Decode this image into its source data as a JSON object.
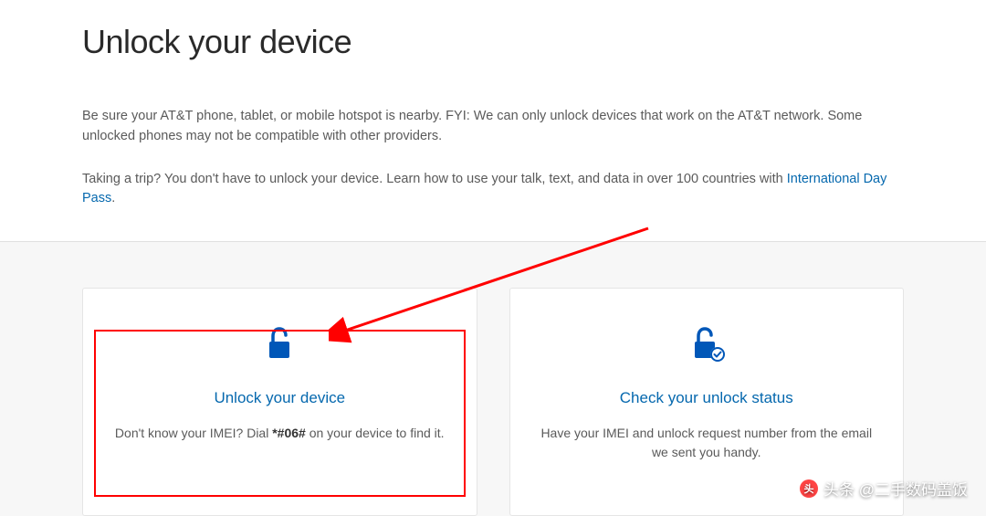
{
  "header": {
    "title": "Unlock your device",
    "intro": "Be sure your AT&T phone, tablet, or mobile hotspot is nearby. FYI: We can only unlock devices that work on the AT&T network. Some unlocked phones may not be compatible with other providers.",
    "trip_prefix": "Taking a trip? You don't have to unlock your device. Learn how to use your talk, text, and data in over 100 countries with ",
    "trip_link": "International Day Pass",
    "trip_suffix": "."
  },
  "cards": {
    "unlock": {
      "title": "Unlock your device",
      "desc_prefix": "Don't know your IMEI? Dial ",
      "desc_bold": "*#06#",
      "desc_suffix": " on your device to find it."
    },
    "status": {
      "title": "Check your unlock status",
      "desc": "Have your IMEI and unlock request number from the email we sent you handy."
    }
  },
  "watermark": {
    "text": "头条 @二手数码盖饭"
  },
  "colors": {
    "link_blue": "#0568ae",
    "icon_blue": "#0057b8",
    "highlight_red": "#ff0000"
  }
}
